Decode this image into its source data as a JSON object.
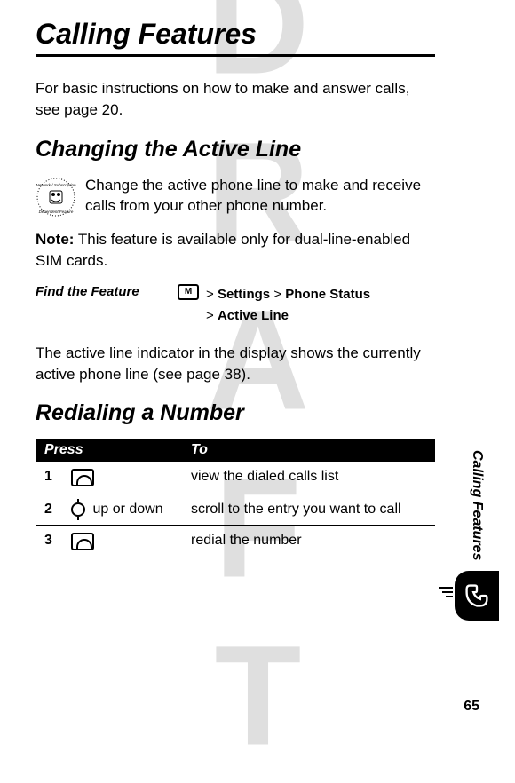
{
  "watermark": "DRAFT",
  "title": "Calling Features",
  "intro": "For basic instructions on how to make and answer calls, see page 20.",
  "section1": {
    "heading": "Changing the Active Line",
    "para1": "Change the active phone line to make and receive calls from your other phone number.",
    "note_label": "Note:",
    "note_text": " This feature is available only for dual-line-enabled SIM cards.",
    "find_label": "Find the Feature",
    "menu_key": "M",
    "path_sep": ">",
    "path1": "Settings",
    "path2": "Phone Status",
    "path3": "Active Line",
    "para2": "The active line indicator in the display shows the currently active phone line (see page 38)."
  },
  "section2": {
    "heading": "Redialing a Number",
    "table": {
      "headers": {
        "press": "Press",
        "to": "To"
      },
      "rows": [
        {
          "num": "1",
          "press_text": "",
          "to": "view the dialed calls list"
        },
        {
          "num": "2",
          "press_text": " up or down",
          "to": "scroll to the entry you want to call"
        },
        {
          "num": "3",
          "press_text": "",
          "to": "redial the number"
        }
      ]
    }
  },
  "side_label": "Calling Features",
  "page_number": "65"
}
